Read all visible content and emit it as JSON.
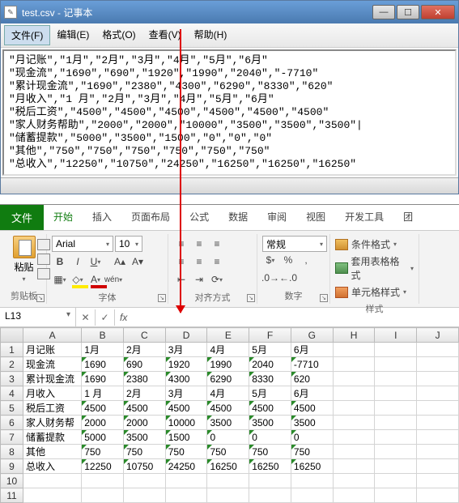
{
  "notepad": {
    "title": "test.csv - 记事本",
    "menu": {
      "file": "文件(F)",
      "edit": "编辑(E)",
      "format": "格式(O)",
      "view": "查看(V)",
      "help": "帮助(H)"
    },
    "content": "\"月记账\",\"1月\",\"2月\",\"3月\",\"4月\",\"5月\",\"6月\"\n\"现金流\",\"1690\",\"690\",\"1920\",\"1990\",\"2040\",\"-7710\"\n\"累计现金流\",\"1690\",\"2380\",\"4300\",\"6290\",\"8330\",\"620\"\n\"月收入\",\"1 月\",\"2月\",\"3月\",\"4月\",\"5月\",\"6月\"\n\"税后工资\",\"4500\",\"4500\",\"4500\",\"4500\",\"4500\",\"4500\"\n\"家人财务帮助\",\"2000\",\"2000\",\"10000\",\"3500\",\"3500\",\"3500\"|\n\"储蓄提款\",\"5000\",\"3500\",\"1500\",\"0\",\"0\",\"0\"\n\"其他\",\"750\",\"750\",\"750\",\"750\",\"750\",\"750\"\n\"总收入\",\"12250\",\"10750\",\"24250\",\"16250\",\"16250\",\"16250\""
  },
  "excel": {
    "tabs": {
      "file": "文件",
      "home": "开始",
      "insert": "插入",
      "layout": "页面布局",
      "formula": "公式",
      "data": "数据",
      "review": "审阅",
      "view": "视图",
      "dev": "开发工具",
      "team": "团"
    },
    "ribbon": {
      "paste": "粘贴",
      "clipboard": "剪贴板",
      "font": "字体",
      "align": "对齐方式",
      "number": "数字",
      "styles": "样式",
      "font_name": "Arial",
      "font_size": "10",
      "num_format": "常规",
      "cond_fmt": "条件格式",
      "table_fmt": "套用表格格式",
      "cell_fmt": "单元格样式"
    },
    "namebox": "L13",
    "fx": "fx",
    "columns": [
      "A",
      "B",
      "C",
      "D",
      "E",
      "F",
      "G",
      "H",
      "I",
      "J"
    ],
    "rows": [
      {
        "n": "1",
        "c": [
          "月记账",
          "1月",
          "2月",
          "3月",
          "4月",
          "5月",
          "6月",
          "",
          "",
          ""
        ],
        "g": [
          0,
          0,
          0,
          0,
          0,
          0,
          0,
          0,
          0,
          0
        ]
      },
      {
        "n": "2",
        "c": [
          "现金流",
          "1690",
          "690",
          "1920",
          "1990",
          "2040",
          "-7710",
          "",
          "",
          ""
        ],
        "g": [
          0,
          1,
          1,
          1,
          1,
          1,
          1,
          0,
          0,
          0
        ]
      },
      {
        "n": "3",
        "c": [
          "累计现金流",
          "1690",
          "2380",
          "4300",
          "6290",
          "8330",
          "620",
          "",
          "",
          ""
        ],
        "g": [
          0,
          1,
          1,
          1,
          1,
          1,
          1,
          0,
          0,
          0
        ]
      },
      {
        "n": "4",
        "c": [
          "月收入",
          "1 月",
          "2月",
          "3月",
          "4月",
          "5月",
          "6月",
          "",
          "",
          ""
        ],
        "g": [
          0,
          0,
          0,
          0,
          0,
          0,
          0,
          0,
          0,
          0
        ]
      },
      {
        "n": "5",
        "c": [
          "税后工资",
          "4500",
          "4500",
          "4500",
          "4500",
          "4500",
          "4500",
          "",
          "",
          ""
        ],
        "g": [
          0,
          1,
          1,
          1,
          1,
          1,
          1,
          0,
          0,
          0
        ]
      },
      {
        "n": "6",
        "c": [
          "家人财务帮",
          "2000",
          "2000",
          "10000",
          "3500",
          "3500",
          "3500",
          "",
          "",
          ""
        ],
        "g": [
          0,
          1,
          1,
          1,
          1,
          1,
          1,
          0,
          0,
          0
        ]
      },
      {
        "n": "7",
        "c": [
          "储蓄提款",
          "5000",
          "3500",
          "1500",
          "0",
          "0",
          "0",
          "",
          "",
          ""
        ],
        "g": [
          0,
          1,
          1,
          1,
          1,
          1,
          1,
          0,
          0,
          0
        ]
      },
      {
        "n": "8",
        "c": [
          "其他",
          "750",
          "750",
          "750",
          "750",
          "750",
          "750",
          "",
          "",
          ""
        ],
        "g": [
          0,
          1,
          1,
          1,
          1,
          1,
          1,
          0,
          0,
          0
        ]
      },
      {
        "n": "9",
        "c": [
          "总收入",
          "12250",
          "10750",
          "24250",
          "16250",
          "16250",
          "16250",
          "",
          "",
          ""
        ],
        "g": [
          0,
          1,
          1,
          1,
          1,
          1,
          1,
          0,
          0,
          0
        ]
      },
      {
        "n": "10",
        "c": [
          "",
          "",
          "",
          "",
          "",
          "",
          "",
          "",
          "",
          ""
        ],
        "g": [
          0,
          0,
          0,
          0,
          0,
          0,
          0,
          0,
          0,
          0
        ]
      },
      {
        "n": "11",
        "c": [
          "",
          "",
          "",
          "",
          "",
          "",
          "",
          "",
          "",
          ""
        ],
        "g": [
          0,
          0,
          0,
          0,
          0,
          0,
          0,
          0,
          0,
          0
        ]
      }
    ]
  }
}
